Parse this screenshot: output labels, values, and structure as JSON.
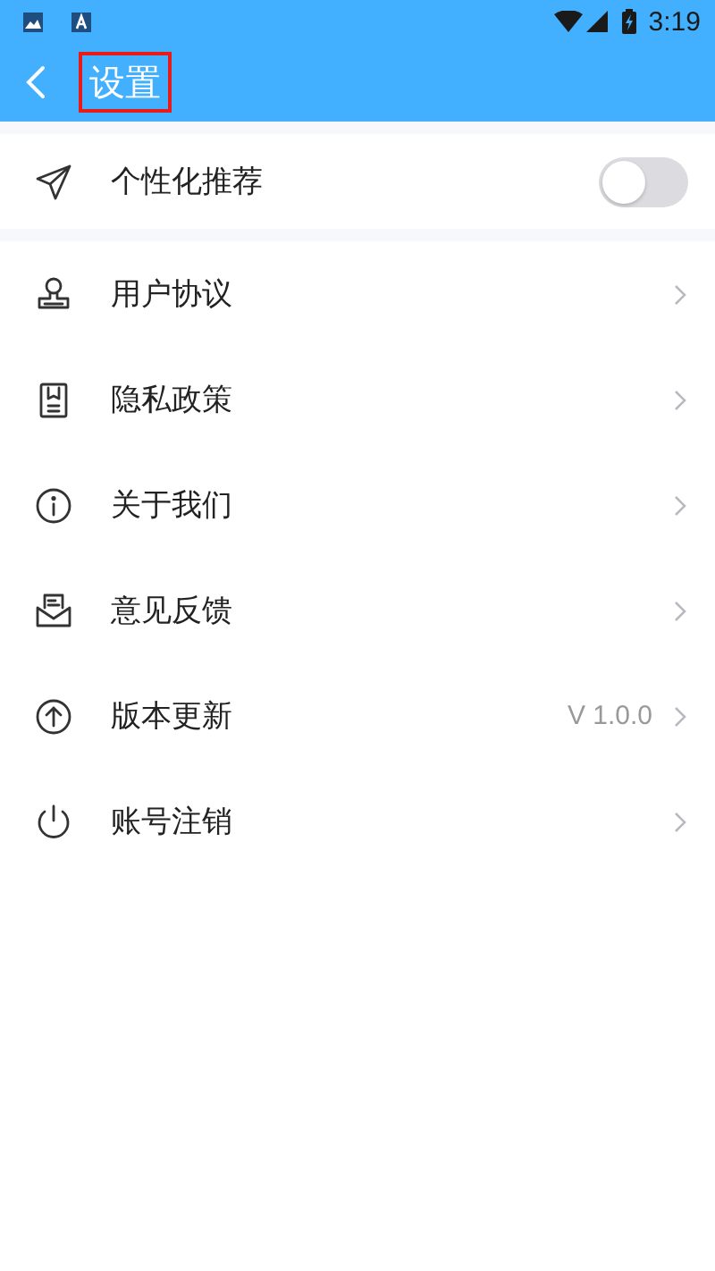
{
  "status_bar": {
    "time": "3:19"
  },
  "app_bar": {
    "title": "设置",
    "title_highlighted": true
  },
  "toggle_row": {
    "label": "个性化推荐",
    "on": false
  },
  "menu": [
    {
      "label": "用户协议"
    },
    {
      "label": "隐私政策"
    },
    {
      "label": "关于我们"
    },
    {
      "label": "意见反馈"
    },
    {
      "label": "版本更新",
      "value": "V 1.0.0"
    },
    {
      "label": "账号注销"
    }
  ]
}
